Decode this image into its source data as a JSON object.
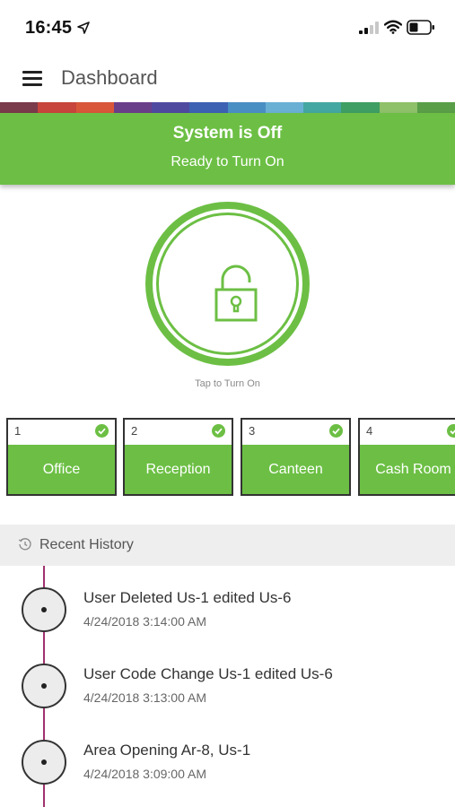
{
  "status_bar": {
    "time": "16:45",
    "icons": [
      "location-arrow-icon",
      "cellular-signal-icon",
      "wifi-icon",
      "battery-icon"
    ]
  },
  "app_bar": {
    "title": "Dashboard",
    "menu_icon": "hamburger-menu-icon"
  },
  "stripe_colors": [
    "#7a3b4a",
    "#c7453c",
    "#d9563a",
    "#6a3f8a",
    "#4f4aa0",
    "#3d61b3",
    "#4a8fc4",
    "#6ab0d4",
    "#45a7a1",
    "#3f9e63",
    "#8fc06a",
    "#5a9e48"
  ],
  "system_status": {
    "title": "System is Off",
    "subtitle": "Ready to Turn On",
    "color": "#6cbf44"
  },
  "arm_control": {
    "icon": "unlocked-padlock-icon",
    "hint": "Tap to Turn On"
  },
  "areas": [
    {
      "number": "1",
      "name": "Office",
      "status_icon": "check-circle-icon"
    },
    {
      "number": "2",
      "name": "Reception",
      "status_icon": "check-circle-icon"
    },
    {
      "number": "3",
      "name": "Canteen",
      "status_icon": "check-circle-icon"
    },
    {
      "number": "4",
      "name": "Cash Room",
      "status_icon": "check-circle-icon"
    }
  ],
  "history": {
    "title": "Recent History",
    "icon": "history-clock-icon",
    "timeline_color": "#a0336e",
    "items": [
      {
        "title": "User Deleted Us-1 edited Us-6",
        "time": "4/24/2018 3:14:00 AM"
      },
      {
        "title": "User Code Change Us-1 edited Us-6",
        "time": "4/24/2018 3:13:00 AM"
      },
      {
        "title": "Area Opening Ar-8, Us-1",
        "time": "4/24/2018 3:09:00 AM"
      }
    ]
  }
}
